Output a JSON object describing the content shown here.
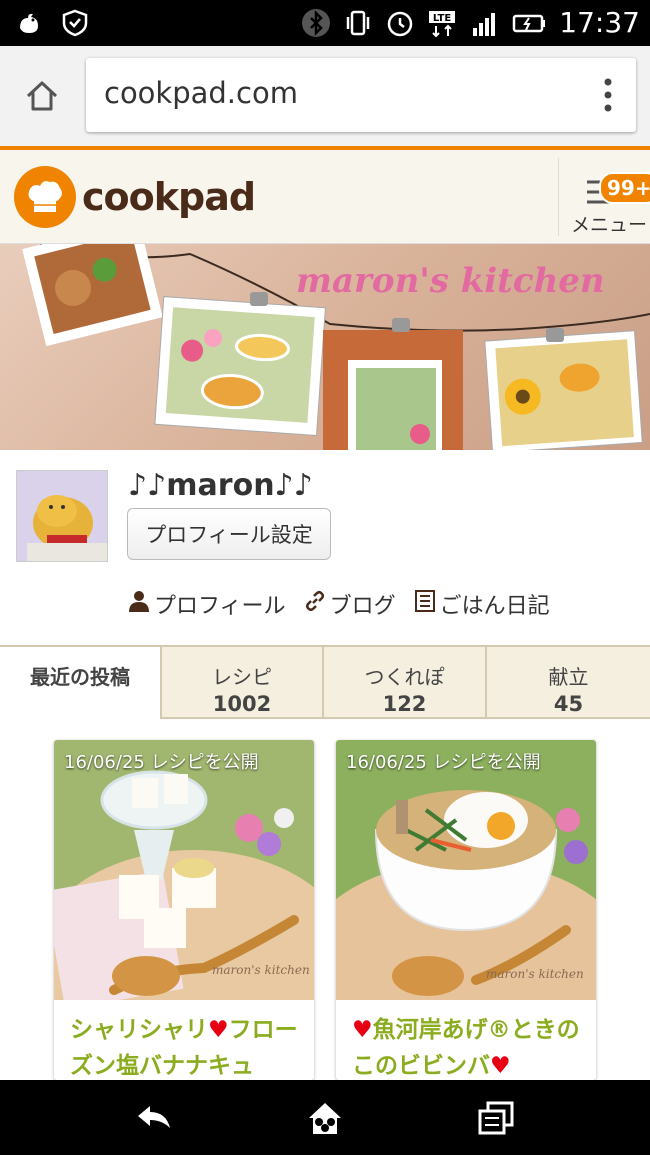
{
  "status_bar": {
    "time": "17:37",
    "network": "LTE"
  },
  "browser": {
    "url": "cookpad.com"
  },
  "header": {
    "logo_text": "cookpad",
    "menu_label": "メニュー",
    "badge": "99+"
  },
  "banner": {
    "text": "maron's kitchen"
  },
  "profile": {
    "name": "♪♪maron♪♪",
    "settings_button": "プロフィール設定",
    "links": [
      {
        "label": "プロフィール",
        "icon": "person-icon"
      },
      {
        "label": "ブログ",
        "icon": "link-icon"
      },
      {
        "label": "ごはん日記",
        "icon": "diary-icon"
      }
    ]
  },
  "tabs": [
    {
      "label": "最近の投稿",
      "count": ""
    },
    {
      "label": "レシピ",
      "count": "1002"
    },
    {
      "label": "つくれぽ",
      "count": "122"
    },
    {
      "label": "献立",
      "count": "45"
    }
  ],
  "cards": [
    {
      "date": "16/06/25 レシピを公開",
      "title_line1": "シャリシャリ",
      "heart": "♥",
      "title_rest": "フローズン塩バナナキュ",
      "watermark": "maron's kitchen"
    },
    {
      "date": "16/06/25 レシピを公開",
      "heart": "♥",
      "title_line1": "魚河岸あげ®ときのこのビビンバ",
      "watermark": "maron's kitchen"
    }
  ],
  "colors": {
    "accent": "#f08300",
    "title_green": "#8bac1e",
    "heart_red": "#e60012",
    "brown": "#4a2a19"
  }
}
